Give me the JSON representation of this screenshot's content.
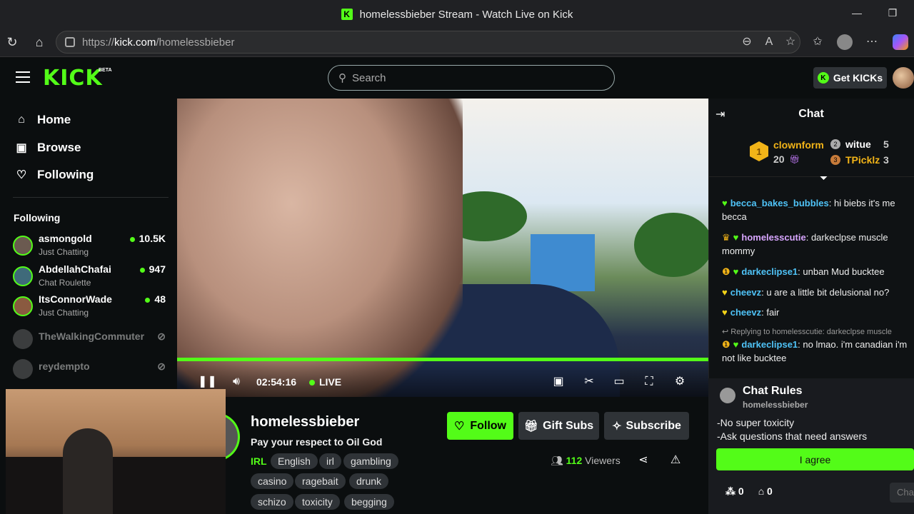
{
  "browser": {
    "title": "homelessbieber Stream - Watch Live on Kick",
    "url_prefix": "https://",
    "url_host": "kick.com",
    "url_path": "/homelessbieber"
  },
  "header": {
    "logo": "KICK",
    "beta": "BETA",
    "search_placeholder": "Search",
    "get_kicks": "Get KICKs"
  },
  "sidebar": {
    "nav": [
      {
        "label": "Home",
        "icon": "home-icon"
      },
      {
        "label": "Browse",
        "icon": "browse-icon"
      },
      {
        "label": "Following",
        "icon": "heart-icon"
      }
    ],
    "following_header": "Following",
    "channels": [
      {
        "name": "asmongold",
        "category": "Just Chatting",
        "viewers": "10.5K",
        "live": true
      },
      {
        "name": "AbdellahChafai",
        "category": "Chat Roulette",
        "viewers": "947",
        "live": true
      },
      {
        "name": "ItsConnorWade",
        "category": "Just Chatting",
        "viewers": "48",
        "live": true
      },
      {
        "name": "TheWalkingCommuter",
        "category": "",
        "viewers": "",
        "live": false
      },
      {
        "name": "reydempto",
        "category": "",
        "viewers": "",
        "live": false
      }
    ]
  },
  "player": {
    "time": "02:54:16",
    "live": "LIVE"
  },
  "stream": {
    "name": "homelessbieber",
    "title": "Pay your respect to Oil God",
    "category": "IRL",
    "tags": [
      "English",
      "irl",
      "gambling",
      "casino",
      "ragebait",
      "drunk",
      "schizo",
      "toxicity",
      "begging"
    ],
    "follow": "Follow",
    "gift": "Gift Subs",
    "subscribe": "Subscribe",
    "viewers_count": "112",
    "viewers_label": "Viewers"
  },
  "chat": {
    "header": "Chat",
    "leaderboard": [
      {
        "rank": "1",
        "name": "clownform",
        "count": "20",
        "color": "#f2b418"
      },
      {
        "rank": "2",
        "name": "witue",
        "count": "5",
        "color": "#ffffff"
      },
      {
        "rank": "3",
        "name": "TPicklz",
        "count": "3",
        "color": "#f2b418"
      }
    ],
    "messages": [
      {
        "user": "becca_bakes_bubbles",
        "color": "#4fc3f7",
        "text": "hi biebs it's me becca"
      },
      {
        "user": "homelesscutie",
        "color": "#d8a6ff",
        "text": "darkeclpse muscle mommy"
      },
      {
        "user": "darkeclipse1",
        "color": "#4fc3f7",
        "text": "unban Mud bucktee"
      },
      {
        "user": "cheevz",
        "color": "#4fc3f7",
        "text": "u are a little bit delusional no?"
      },
      {
        "user": "cheevz",
        "color": "#4fc3f7",
        "text": "fair"
      },
      {
        "user": "darkeclipse1",
        "color": "#4fc3f7",
        "text": "no lmao. i'm canadian i'm not like bucktee"
      }
    ],
    "reply_note": "Replying to homelesscutie: darkeclpse muscle",
    "rules": {
      "title": "Chat Rules",
      "by": "homelessbieber",
      "items": [
        "-No super toxicity",
        "-Ask questions that need answers"
      ],
      "agree": "I agree"
    },
    "footer": {
      "kicks": "0",
      "store": "0",
      "input_placeholder": "Cha"
    }
  }
}
